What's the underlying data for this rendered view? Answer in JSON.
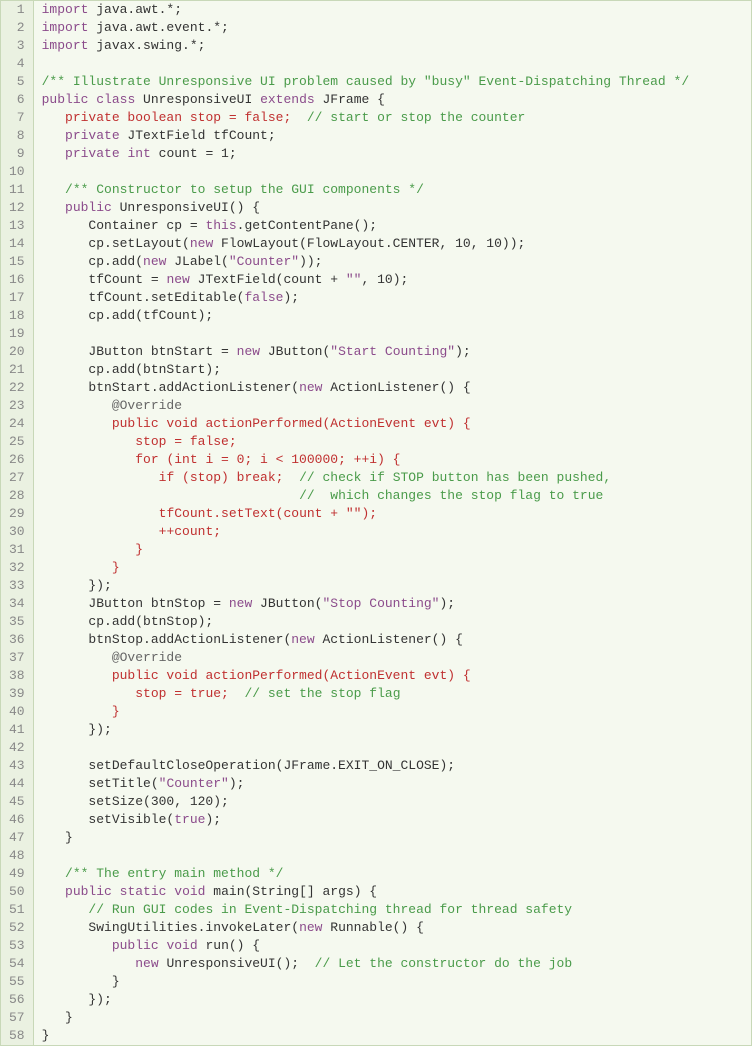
{
  "lines": [
    {
      "n": 1,
      "segs": [
        {
          "c": "kw",
          "t": "import"
        },
        {
          "c": "plain",
          "t": " java.awt.*;"
        }
      ]
    },
    {
      "n": 2,
      "segs": [
        {
          "c": "kw",
          "t": "import"
        },
        {
          "c": "plain",
          "t": " java.awt.event.*;"
        }
      ]
    },
    {
      "n": 3,
      "segs": [
        {
          "c": "kw",
          "t": "import"
        },
        {
          "c": "plain",
          "t": " javax.swing.*;"
        }
      ]
    },
    {
      "n": 4,
      "segs": [
        {
          "c": "plain",
          "t": " "
        }
      ]
    },
    {
      "n": 5,
      "segs": [
        {
          "c": "comment",
          "t": "/** Illustrate Unresponsive UI problem caused by \"busy\" Event-Dispatching Thread */"
        }
      ]
    },
    {
      "n": 6,
      "segs": [
        {
          "c": "kw",
          "t": "public"
        },
        {
          "c": "plain",
          "t": " "
        },
        {
          "c": "kw",
          "t": "class"
        },
        {
          "c": "plain",
          "t": " UnresponsiveUI "
        },
        {
          "c": "kw",
          "t": "extends"
        },
        {
          "c": "plain",
          "t": " JFrame {"
        }
      ]
    },
    {
      "n": 7,
      "segs": [
        {
          "c": "plain",
          "t": "   "
        },
        {
          "c": "red",
          "t": "private boolean stop = false;"
        },
        {
          "c": "plain",
          "t": "  "
        },
        {
          "c": "comment",
          "t": "// start or stop the counter"
        }
      ]
    },
    {
      "n": 8,
      "segs": [
        {
          "c": "plain",
          "t": "   "
        },
        {
          "c": "kw",
          "t": "private"
        },
        {
          "c": "plain",
          "t": " JTextField tfCount;"
        }
      ]
    },
    {
      "n": 9,
      "segs": [
        {
          "c": "plain",
          "t": "   "
        },
        {
          "c": "kw",
          "t": "private"
        },
        {
          "c": "plain",
          "t": " "
        },
        {
          "c": "kw",
          "t": "int"
        },
        {
          "c": "plain",
          "t": " count = 1;"
        }
      ]
    },
    {
      "n": 10,
      "segs": [
        {
          "c": "plain",
          "t": " "
        }
      ]
    },
    {
      "n": 11,
      "segs": [
        {
          "c": "plain",
          "t": "   "
        },
        {
          "c": "comment",
          "t": "/** Constructor to setup the GUI components */"
        }
      ]
    },
    {
      "n": 12,
      "segs": [
        {
          "c": "plain",
          "t": "   "
        },
        {
          "c": "kw",
          "t": "public"
        },
        {
          "c": "plain",
          "t": " UnresponsiveUI() {"
        }
      ]
    },
    {
      "n": 13,
      "segs": [
        {
          "c": "plain",
          "t": "      Container cp = "
        },
        {
          "c": "kw",
          "t": "this"
        },
        {
          "c": "plain",
          "t": ".getContentPane();"
        }
      ]
    },
    {
      "n": 14,
      "segs": [
        {
          "c": "plain",
          "t": "      cp.setLayout("
        },
        {
          "c": "kw",
          "t": "new"
        },
        {
          "c": "plain",
          "t": " FlowLayout(FlowLayout.CENTER, 10, 10));"
        }
      ]
    },
    {
      "n": 15,
      "segs": [
        {
          "c": "plain",
          "t": "      cp.add("
        },
        {
          "c": "kw",
          "t": "new"
        },
        {
          "c": "plain",
          "t": " JLabel("
        },
        {
          "c": "str",
          "t": "\"Counter\""
        },
        {
          "c": "plain",
          "t": "));"
        }
      ]
    },
    {
      "n": 16,
      "segs": [
        {
          "c": "plain",
          "t": "      tfCount = "
        },
        {
          "c": "kw",
          "t": "new"
        },
        {
          "c": "plain",
          "t": " JTextField(count + "
        },
        {
          "c": "str",
          "t": "\"\""
        },
        {
          "c": "plain",
          "t": ", 10);"
        }
      ]
    },
    {
      "n": 17,
      "segs": [
        {
          "c": "plain",
          "t": "      tfCount.setEditable("
        },
        {
          "c": "kw",
          "t": "false"
        },
        {
          "c": "plain",
          "t": ");"
        }
      ]
    },
    {
      "n": 18,
      "segs": [
        {
          "c": "plain",
          "t": "      cp.add(tfCount);"
        }
      ]
    },
    {
      "n": 19,
      "segs": [
        {
          "c": "plain",
          "t": " "
        }
      ]
    },
    {
      "n": 20,
      "segs": [
        {
          "c": "plain",
          "t": "      JButton btnStart = "
        },
        {
          "c": "kw",
          "t": "new"
        },
        {
          "c": "plain",
          "t": " JButton("
        },
        {
          "c": "str",
          "t": "\"Start Counting\""
        },
        {
          "c": "plain",
          "t": ");"
        }
      ]
    },
    {
      "n": 21,
      "segs": [
        {
          "c": "plain",
          "t": "      cp.add(btnStart);"
        }
      ]
    },
    {
      "n": 22,
      "segs": [
        {
          "c": "plain",
          "t": "      btnStart.addActionListener("
        },
        {
          "c": "kw",
          "t": "new"
        },
        {
          "c": "plain",
          "t": " ActionListener() {"
        }
      ]
    },
    {
      "n": 23,
      "segs": [
        {
          "c": "plain",
          "t": "         "
        },
        {
          "c": "ann",
          "t": "@Override"
        }
      ]
    },
    {
      "n": 24,
      "segs": [
        {
          "c": "plain",
          "t": "         "
        },
        {
          "c": "red",
          "t": "public void actionPerformed(ActionEvent evt) {"
        }
      ]
    },
    {
      "n": 25,
      "segs": [
        {
          "c": "plain",
          "t": "            "
        },
        {
          "c": "red",
          "t": "stop = false;"
        }
      ]
    },
    {
      "n": 26,
      "segs": [
        {
          "c": "plain",
          "t": "            "
        },
        {
          "c": "red",
          "t": "for (int i = 0; i < 100000; ++i) {"
        }
      ]
    },
    {
      "n": 27,
      "segs": [
        {
          "c": "plain",
          "t": "               "
        },
        {
          "c": "red",
          "t": "if (stop) break;"
        },
        {
          "c": "plain",
          "t": "  "
        },
        {
          "c": "comment",
          "t": "// check if STOP button has been pushed,"
        }
      ]
    },
    {
      "n": 28,
      "segs": [
        {
          "c": "plain",
          "t": "                                 "
        },
        {
          "c": "comment",
          "t": "//  which changes the stop flag to true"
        }
      ]
    },
    {
      "n": 29,
      "segs": [
        {
          "c": "plain",
          "t": "               "
        },
        {
          "c": "red",
          "t": "tfCount.setText(count + \"\");"
        }
      ]
    },
    {
      "n": 30,
      "segs": [
        {
          "c": "plain",
          "t": "               "
        },
        {
          "c": "red",
          "t": "++count;"
        }
      ]
    },
    {
      "n": 31,
      "segs": [
        {
          "c": "plain",
          "t": "            "
        },
        {
          "c": "red",
          "t": "}"
        }
      ]
    },
    {
      "n": 32,
      "segs": [
        {
          "c": "plain",
          "t": "         "
        },
        {
          "c": "red",
          "t": "}"
        }
      ]
    },
    {
      "n": 33,
      "segs": [
        {
          "c": "plain",
          "t": "      });"
        }
      ]
    },
    {
      "n": 34,
      "segs": [
        {
          "c": "plain",
          "t": "      JButton btnStop = "
        },
        {
          "c": "kw",
          "t": "new"
        },
        {
          "c": "plain",
          "t": " JButton("
        },
        {
          "c": "str",
          "t": "\"Stop Counting\""
        },
        {
          "c": "plain",
          "t": ");"
        }
      ]
    },
    {
      "n": 35,
      "segs": [
        {
          "c": "plain",
          "t": "      cp.add(btnStop);"
        }
      ]
    },
    {
      "n": 36,
      "segs": [
        {
          "c": "plain",
          "t": "      btnStop.addActionListener("
        },
        {
          "c": "kw",
          "t": "new"
        },
        {
          "c": "plain",
          "t": " ActionListener() {"
        }
      ]
    },
    {
      "n": 37,
      "segs": [
        {
          "c": "plain",
          "t": "         "
        },
        {
          "c": "ann",
          "t": "@Override"
        }
      ]
    },
    {
      "n": 38,
      "segs": [
        {
          "c": "plain",
          "t": "         "
        },
        {
          "c": "red",
          "t": "public void actionPerformed(ActionEvent evt) {"
        }
      ]
    },
    {
      "n": 39,
      "segs": [
        {
          "c": "plain",
          "t": "            "
        },
        {
          "c": "red",
          "t": "stop = true;"
        },
        {
          "c": "plain",
          "t": "  "
        },
        {
          "c": "comment",
          "t": "// set the stop flag"
        }
      ]
    },
    {
      "n": 40,
      "segs": [
        {
          "c": "plain",
          "t": "         "
        },
        {
          "c": "red",
          "t": "}"
        }
      ]
    },
    {
      "n": 41,
      "segs": [
        {
          "c": "plain",
          "t": "      });"
        }
      ]
    },
    {
      "n": 42,
      "segs": [
        {
          "c": "plain",
          "t": " "
        }
      ]
    },
    {
      "n": 43,
      "segs": [
        {
          "c": "plain",
          "t": "      setDefaultCloseOperation(JFrame.EXIT_ON_CLOSE);"
        }
      ]
    },
    {
      "n": 44,
      "segs": [
        {
          "c": "plain",
          "t": "      setTitle("
        },
        {
          "c": "str",
          "t": "\"Counter\""
        },
        {
          "c": "plain",
          "t": ");"
        }
      ]
    },
    {
      "n": 45,
      "segs": [
        {
          "c": "plain",
          "t": "      setSize(300, 120);"
        }
      ]
    },
    {
      "n": 46,
      "segs": [
        {
          "c": "plain",
          "t": "      setVisible("
        },
        {
          "c": "kw",
          "t": "true"
        },
        {
          "c": "plain",
          "t": ");"
        }
      ]
    },
    {
      "n": 47,
      "segs": [
        {
          "c": "plain",
          "t": "   }"
        }
      ]
    },
    {
      "n": 48,
      "segs": [
        {
          "c": "plain",
          "t": " "
        }
      ]
    },
    {
      "n": 49,
      "segs": [
        {
          "c": "plain",
          "t": "   "
        },
        {
          "c": "comment",
          "t": "/** The entry main method */"
        }
      ]
    },
    {
      "n": 50,
      "segs": [
        {
          "c": "plain",
          "t": "   "
        },
        {
          "c": "kw",
          "t": "public"
        },
        {
          "c": "plain",
          "t": " "
        },
        {
          "c": "kw",
          "t": "static"
        },
        {
          "c": "plain",
          "t": " "
        },
        {
          "c": "kw",
          "t": "void"
        },
        {
          "c": "plain",
          "t": " main(String[] args) {"
        }
      ]
    },
    {
      "n": 51,
      "segs": [
        {
          "c": "plain",
          "t": "      "
        },
        {
          "c": "comment",
          "t": "// Run GUI codes in Event-Dispatching thread for thread safety"
        }
      ]
    },
    {
      "n": 52,
      "segs": [
        {
          "c": "plain",
          "t": "      SwingUtilities.invokeLater("
        },
        {
          "c": "kw",
          "t": "new"
        },
        {
          "c": "plain",
          "t": " Runnable() {"
        }
      ]
    },
    {
      "n": 53,
      "segs": [
        {
          "c": "plain",
          "t": "         "
        },
        {
          "c": "kw",
          "t": "public"
        },
        {
          "c": "plain",
          "t": " "
        },
        {
          "c": "kw",
          "t": "void"
        },
        {
          "c": "plain",
          "t": " run() {"
        }
      ]
    },
    {
      "n": 54,
      "segs": [
        {
          "c": "plain",
          "t": "            "
        },
        {
          "c": "kw",
          "t": "new"
        },
        {
          "c": "plain",
          "t": " UnresponsiveUI();  "
        },
        {
          "c": "comment",
          "t": "// Let the constructor do the job"
        }
      ]
    },
    {
      "n": 55,
      "segs": [
        {
          "c": "plain",
          "t": "         }"
        }
      ]
    },
    {
      "n": 56,
      "segs": [
        {
          "c": "plain",
          "t": "      });"
        }
      ]
    },
    {
      "n": 57,
      "segs": [
        {
          "c": "plain",
          "t": "   }"
        }
      ]
    },
    {
      "n": 58,
      "segs": [
        {
          "c": "plain",
          "t": "}"
        }
      ]
    }
  ]
}
